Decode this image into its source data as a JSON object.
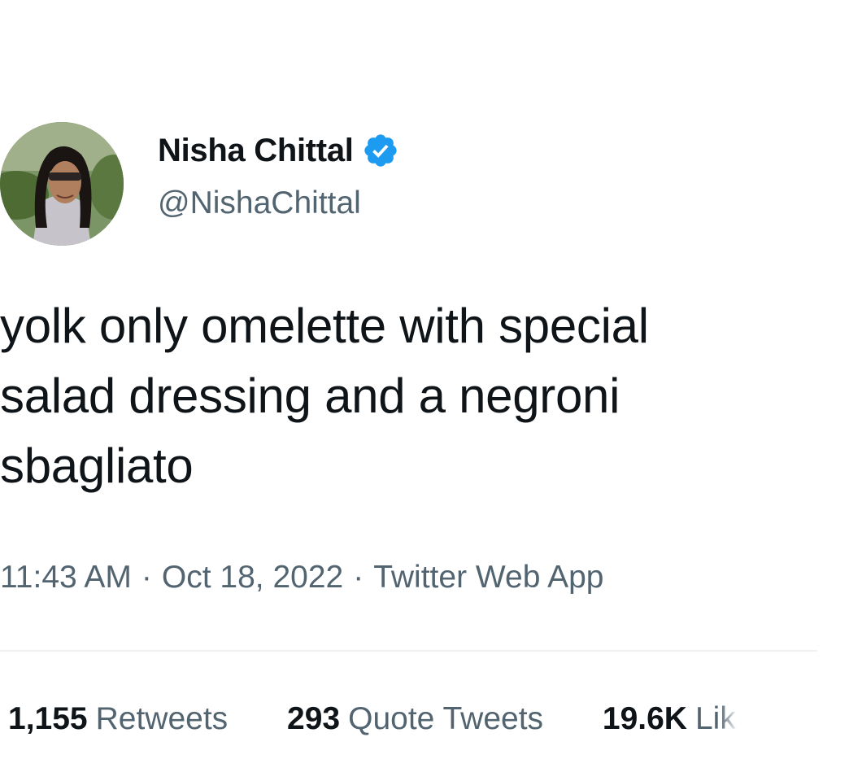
{
  "author": {
    "display_name": "Nisha Chittal",
    "handle": "@NishaChittal",
    "verified": true,
    "verified_color": "#1d9bf0"
  },
  "tweet": {
    "lines": [
      "yolk only omelette with special",
      "salad dressing and a negroni",
      "sbagliato"
    ]
  },
  "meta": {
    "time": "11:43 AM",
    "date": "Oct 18, 2022",
    "source": "Twitter Web App",
    "separator": "·"
  },
  "stats": {
    "retweets_count": "1,155",
    "retweets_label": "Retweets",
    "quotes_count": "293",
    "quotes_label": "Quote Tweets",
    "likes_count": "19.6K",
    "likes_label": "Lik"
  },
  "icons": {
    "verified": "verified-badge-icon",
    "avatar": "profile-avatar"
  }
}
